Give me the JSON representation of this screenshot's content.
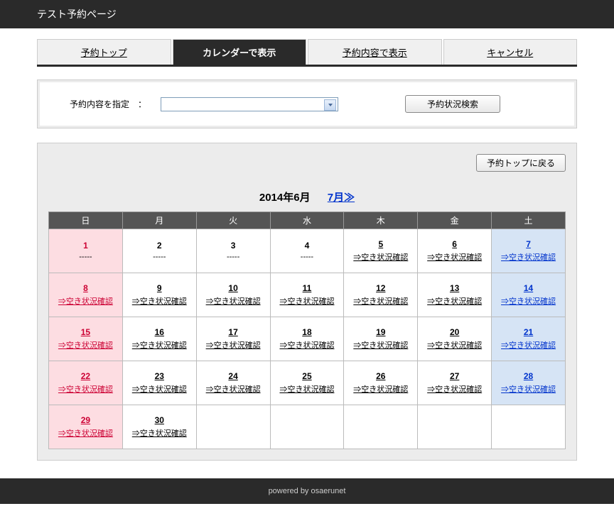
{
  "header": {
    "title": "テスト予約ページ"
  },
  "tabs": [
    {
      "label": "予約トップ",
      "active": false
    },
    {
      "label": "カレンダーで表示",
      "active": true
    },
    {
      "label": "予約内容で表示",
      "active": false
    },
    {
      "label": "キャンセル",
      "active": false
    }
  ],
  "filter": {
    "label": "予約内容を指定　：",
    "search_btn": "予約状況検索"
  },
  "calendar": {
    "back_btn": "予約トップに戻る",
    "current": "2014年6月",
    "next": "7月≫",
    "weekdays": [
      "日",
      "月",
      "火",
      "水",
      "木",
      "金",
      "土"
    ],
    "check_label": "⇒空き状況確認",
    "dash": "-----",
    "weeks": [
      [
        {
          "d": "1",
          "type": "sun",
          "link": false
        },
        {
          "d": "2",
          "type": "",
          "link": false
        },
        {
          "d": "3",
          "type": "",
          "link": false
        },
        {
          "d": "4",
          "type": "",
          "link": false
        },
        {
          "d": "5",
          "type": "",
          "link": true
        },
        {
          "d": "6",
          "type": "",
          "link": true
        },
        {
          "d": "7",
          "type": "sat",
          "link": true
        }
      ],
      [
        {
          "d": "8",
          "type": "sun",
          "link": true
        },
        {
          "d": "9",
          "type": "",
          "link": true
        },
        {
          "d": "10",
          "type": "",
          "link": true
        },
        {
          "d": "11",
          "type": "",
          "link": true
        },
        {
          "d": "12",
          "type": "",
          "link": true
        },
        {
          "d": "13",
          "type": "",
          "link": true
        },
        {
          "d": "14",
          "type": "sat",
          "link": true
        }
      ],
      [
        {
          "d": "15",
          "type": "sun",
          "link": true
        },
        {
          "d": "16",
          "type": "",
          "link": true
        },
        {
          "d": "17",
          "type": "",
          "link": true
        },
        {
          "d": "18",
          "type": "",
          "link": true
        },
        {
          "d": "19",
          "type": "",
          "link": true
        },
        {
          "d": "20",
          "type": "",
          "link": true
        },
        {
          "d": "21",
          "type": "sat",
          "link": true
        }
      ],
      [
        {
          "d": "22",
          "type": "sun",
          "link": true
        },
        {
          "d": "23",
          "type": "",
          "link": true
        },
        {
          "d": "24",
          "type": "",
          "link": true
        },
        {
          "d": "25",
          "type": "",
          "link": true
        },
        {
          "d": "26",
          "type": "",
          "link": true
        },
        {
          "d": "27",
          "type": "",
          "link": true
        },
        {
          "d": "28",
          "type": "sat",
          "link": true
        }
      ],
      [
        {
          "d": "29",
          "type": "sun",
          "link": true
        },
        {
          "d": "30",
          "type": "",
          "link": true
        },
        {
          "d": "",
          "type": "empty",
          "link": false
        },
        {
          "d": "",
          "type": "empty",
          "link": false
        },
        {
          "d": "",
          "type": "empty",
          "link": false
        },
        {
          "d": "",
          "type": "empty",
          "link": false
        },
        {
          "d": "",
          "type": "empty",
          "link": false
        }
      ]
    ]
  },
  "footer": {
    "text": "powered by osaerunet"
  }
}
